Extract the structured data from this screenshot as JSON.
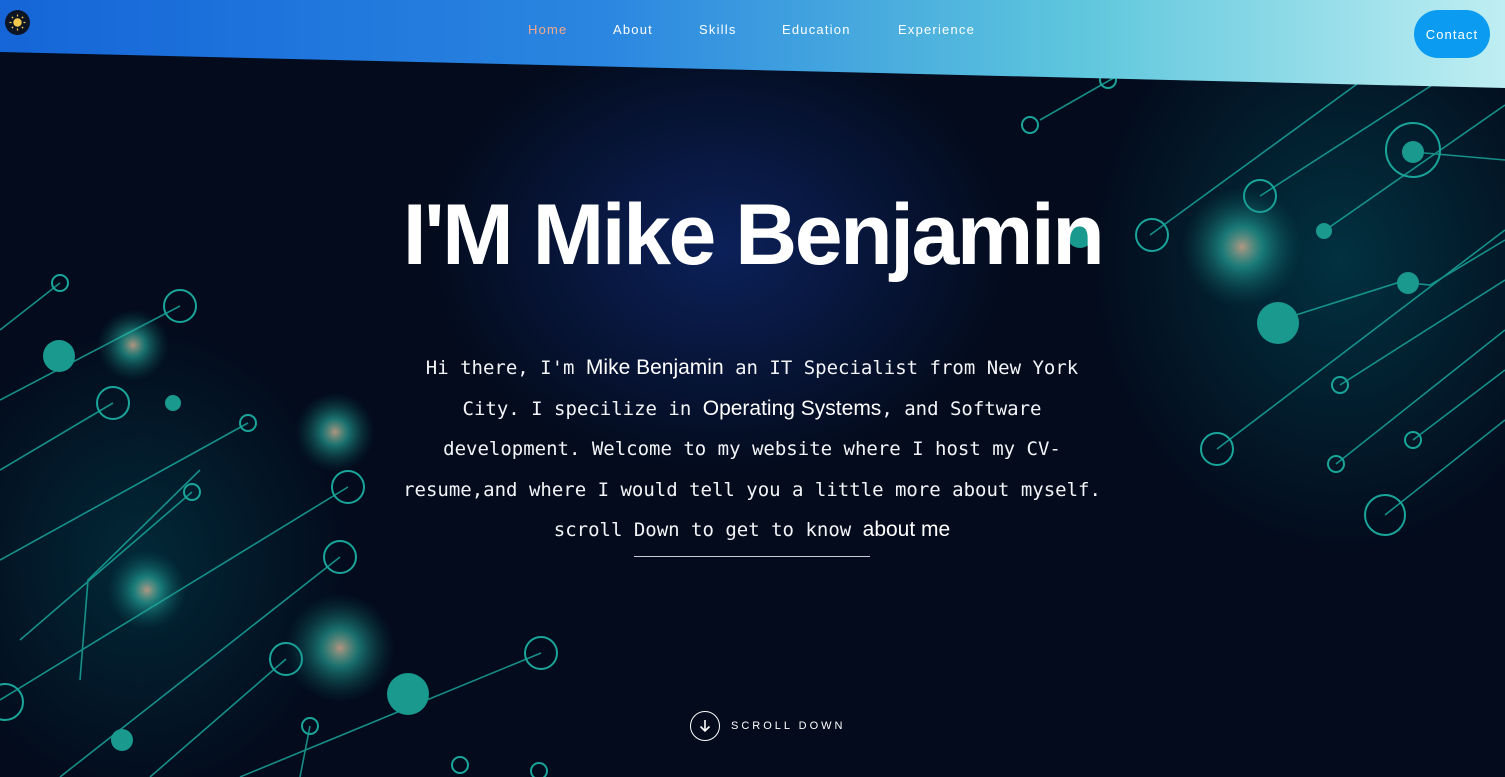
{
  "nav": {
    "items": [
      {
        "label": "Home",
        "active": true
      },
      {
        "label": "About",
        "active": false
      },
      {
        "label": "Skills",
        "active": false
      },
      {
        "label": "Education",
        "active": false
      },
      {
        "label": "Experience",
        "active": false
      }
    ],
    "contact_label": "Contact",
    "logo_icon": "theme-toggle-icon"
  },
  "hero": {
    "title": "I'M Mike Benjamin",
    "intro": {
      "p1": "Hi there, I'm ",
      "name": "Mike Benjamin",
      "p2": " an IT Specialist from New York City. I specilize in ",
      "os": "Operating Systems",
      "p3": ", and Software development. Welcome to my website where I host my CV-resume,and where I would tell you a little more about myself. scroll Down to get to know ",
      "about": "about me"
    },
    "scroll_label": "SCROLL DOWN",
    "scroll_icon": "arrow-down-circle-icon"
  },
  "colors": {
    "background": "#030b1c",
    "accent_teal": "#1fb8a8",
    "nav_active": "#f5a887",
    "contact_button": "#0b9cf2"
  }
}
